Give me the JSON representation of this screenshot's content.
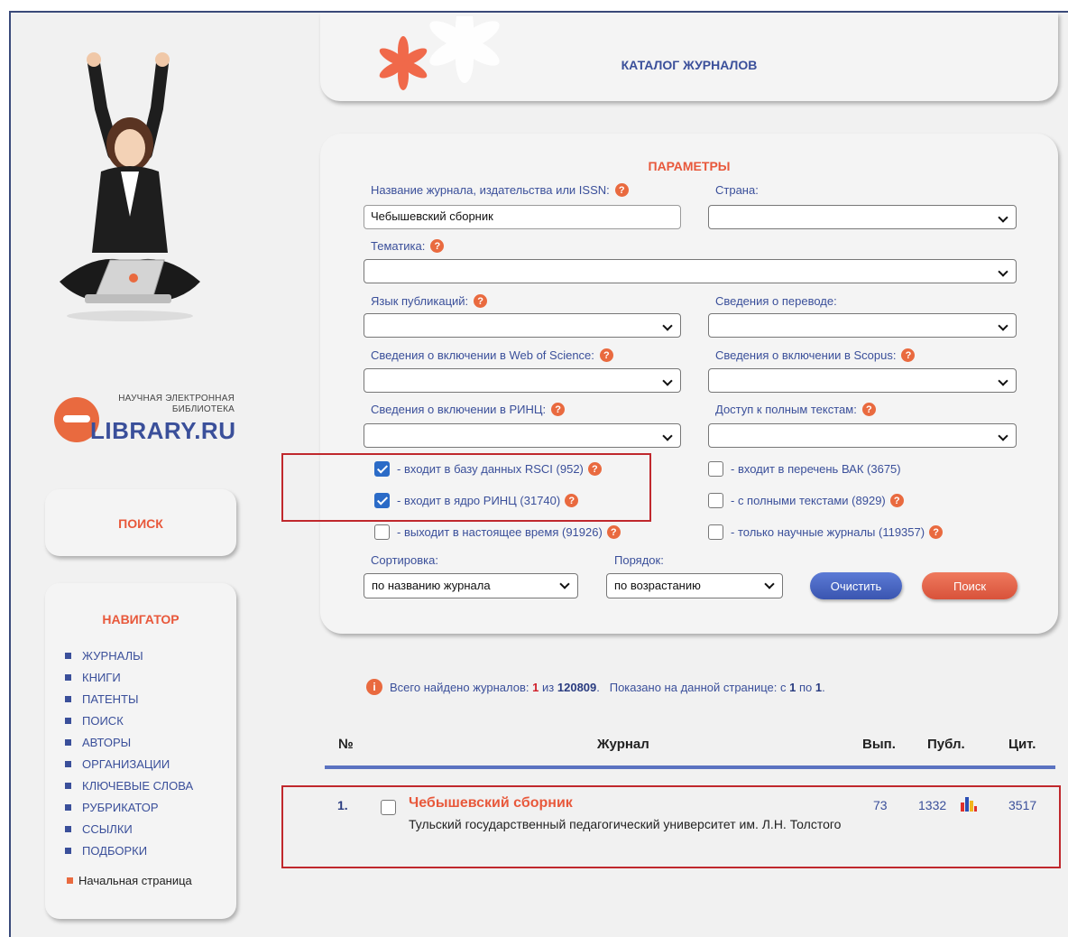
{
  "brand": {
    "tagline_line1": "НАУЧНАЯ ЭЛЕКТРОННАЯ",
    "tagline_line2": "БИБЛИОТЕКА",
    "name": "LIBRARY.RU"
  },
  "header": {
    "title": "КАТАЛОГ ЖУРНАЛОВ"
  },
  "search_panel": {
    "label": "ПОИСК"
  },
  "navigator": {
    "title": "НАВИГАТОР",
    "items": [
      "ЖУРНАЛЫ",
      "КНИГИ",
      "ПАТЕНТЫ",
      "ПОИСК",
      "АВТОРЫ",
      "ОРГАНИЗАЦИИ",
      "КЛЮЧЕВЫЕ СЛОВА",
      "РУБРИКАТОР",
      "ССЫЛКИ",
      "ПОДБОРКИ"
    ],
    "home": "Начальная страница"
  },
  "params": {
    "title": "ПАРАМЕТРЫ",
    "journal_name_label": "Название журнала, издательства или ISSN:",
    "journal_name_value": "Чебышевский сборник",
    "country_label": "Страна:",
    "country_value": "",
    "topic_label": "Тематика:",
    "topic_value": "",
    "language_label": "Язык публикаций:",
    "language_value": "",
    "translation_label": "Сведения о переводе:",
    "translation_value": "",
    "wos_label": "Сведения о включении в Web of Science:",
    "wos_value": "",
    "scopus_label": "Сведения о включении в Scopus:",
    "scopus_value": "",
    "rinc_label": "Сведения о включении в РИНЦ:",
    "rinc_value": "",
    "fulltext_access_label": "Доступ к полным текстам:",
    "fulltext_access_value": "",
    "checkboxes": {
      "rsci": {
        "label": "- входит в базу данных RSCI (952)",
        "checked": true
      },
      "rinc_core": {
        "label": "- входит в ядро РИНЦ (31740)",
        "checked": true
      },
      "current": {
        "label": "- выходит в настоящее время (91926)",
        "checked": false
      },
      "vak": {
        "label": "- входит в перечень ВАК (3675)",
        "checked": false
      },
      "full_texts": {
        "label": "- с полными текстами (8929)",
        "checked": false
      },
      "scientific_only": {
        "label": "- только научные журналы (119357)",
        "checked": false
      }
    },
    "sort_label": "Сортировка:",
    "sort_value": "по названию журнала",
    "order_label": "Порядок:",
    "order_value": "по возрастанию",
    "clear_button": "Очистить",
    "search_button": "Поиск"
  },
  "results": {
    "summary_prefix": "Всего найдено журналов:",
    "found": "1",
    "of_word": "из",
    "total": "120809",
    "shown_prefix": "Показано на данной странице: с",
    "from": "1",
    "to_word": "по",
    "to": "1",
    "columns": {
      "num": "№",
      "journal": "Журнал",
      "issues": "Вып.",
      "publications": "Публ.",
      "citations": "Цит."
    },
    "rows": [
      {
        "num": "1.",
        "title": "Чебышевский сборник",
        "publisher": "Тульский государственный педагогический университет им. Л.Н. Толстого",
        "issues": "73",
        "publications": "1332",
        "citations": "3517"
      }
    ]
  },
  "colors": {
    "accent_orange": "#e8583b",
    "brand_blue": "#3a4f9a",
    "highlight_red": "#c0282d"
  }
}
